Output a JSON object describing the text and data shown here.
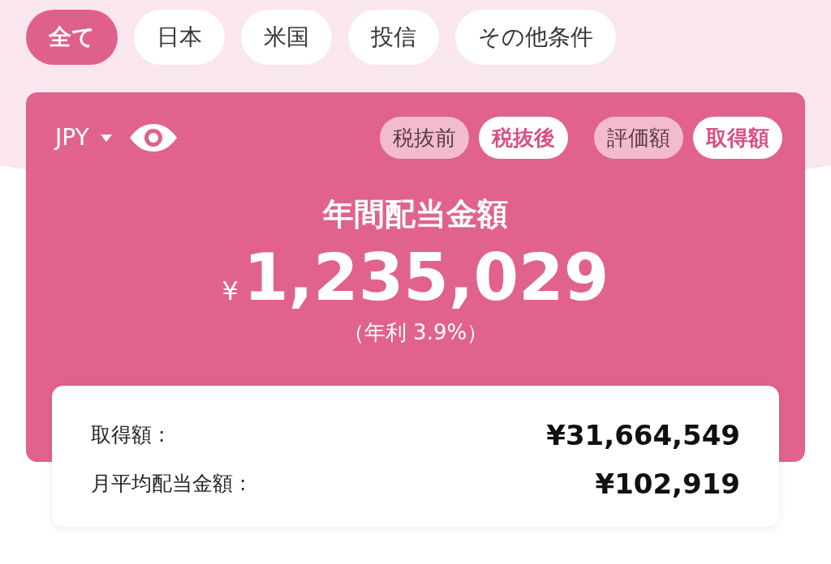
{
  "filters": [
    {
      "label": "全て",
      "selected": true
    },
    {
      "label": "日本",
      "selected": false
    },
    {
      "label": "米国",
      "selected": false
    },
    {
      "label": "投信",
      "selected": false
    },
    {
      "label": "その他条件",
      "selected": false
    }
  ],
  "card": {
    "currency": "JPY",
    "visible": true,
    "tax_toggle": [
      {
        "label": "税抜前",
        "selected": false
      },
      {
        "label": "税抜後",
        "selected": true
      }
    ],
    "basis_toggle": [
      {
        "label": "評価額",
        "selected": false
      },
      {
        "label": "取得額",
        "selected": true
      }
    ],
    "title": "年間配当金額",
    "currency_symbol": "¥",
    "amount": "1,235,029",
    "yield": "（年利 3.9%）"
  },
  "summary": [
    {
      "label": "取得額 :",
      "value": "¥31,664,549"
    },
    {
      "label": "月平均配当金額 :",
      "value": "¥102,919"
    }
  ]
}
